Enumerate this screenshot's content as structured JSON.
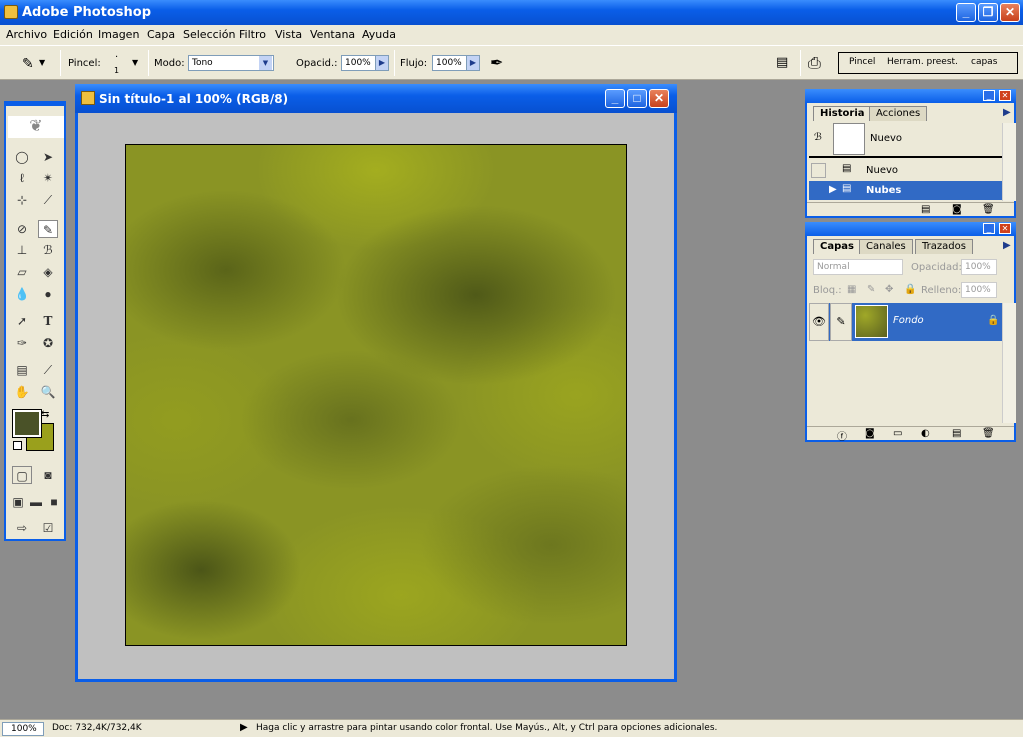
{
  "app": {
    "title": "Adobe Photoshop"
  },
  "menu": [
    "Archivo",
    "Edición",
    "Imagen",
    "Capa",
    "Selección",
    "Filtro",
    "Vista",
    "Ventana",
    "Ayuda"
  ],
  "options": {
    "brush_label": "Pincel:",
    "brush_size": "1",
    "mode_label": "Modo:",
    "mode_value": "Tono",
    "opacity_label": "Opacid.:",
    "opacity_value": "100%",
    "flow_label": "Flujo:",
    "flow_value": "100%"
  },
  "wells": {
    "tab1": "Pincel",
    "tab2": "Herram. preest.",
    "tab3": "capas"
  },
  "document": {
    "title": "Sin título-1 al 100% (RGB/8)"
  },
  "colors": {
    "foreground": "#4a5228",
    "background": "#9aa01c",
    "accent": "#0a5ee8"
  },
  "history": {
    "tabs": [
      "Historia",
      "Acciones"
    ],
    "snapshot_label": "Nuevo",
    "items": [
      {
        "label": "Nuevo"
      },
      {
        "label": "Nubes"
      }
    ]
  },
  "layers": {
    "tabs": [
      "Capas",
      "Canales",
      "Trazados"
    ],
    "blend_mode": "Normal",
    "opacity_label": "Opacidad:",
    "opacity_value": "100%",
    "lock_label": "Bloq.:",
    "fill_label": "Relleno:",
    "fill_value": "100%",
    "layer_name": "Fondo"
  },
  "status": {
    "zoom": "100%",
    "doc": "Doc: 732,4K/732,4K",
    "hint": "Haga clic y arrastre para pintar usando color frontal. Use Mayús., Alt, y Ctrl para opciones adicionales."
  }
}
